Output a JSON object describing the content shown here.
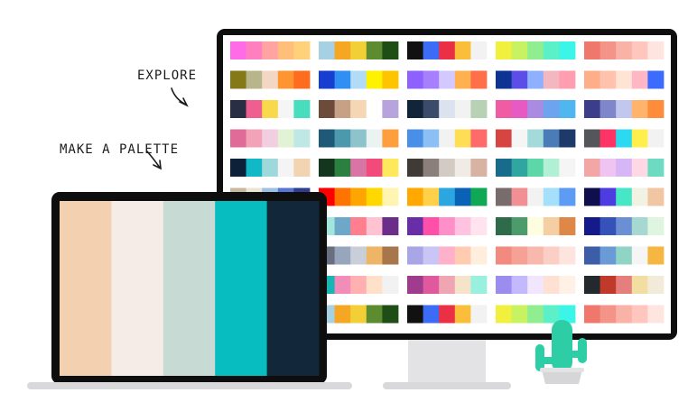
{
  "labels": {
    "explore": "EXPLORE",
    "make_palette": "MAKE A PALETTE"
  },
  "icons": [
    "arrow-explore-icon",
    "arrow-make-palette-icon",
    "cactus-icon"
  ],
  "laptop_palette": [
    "#F2D0B0",
    "#F5ECE8",
    "#C7DAD3",
    "#08BDC0",
    "#12283A"
  ],
  "monitor_palettes": [
    [
      [
        "#FF6BE6",
        "#FF80BF",
        "#FFA3A3",
        "#FFBE7A",
        "#FFD27A"
      ],
      [
        "#A6D0E4",
        "#F5A623",
        "#F2CF36",
        "#5D8B30",
        "#1F4D16"
      ],
      [
        "#111111",
        "#3C6BF5",
        "#EB2F45",
        "#FBBE3A",
        "#F2F2F2"
      ],
      [
        "#F2F03E",
        "#C7F262",
        "#90EE90",
        "#5BF0C8",
        "#3CF5E9"
      ],
      [
        "#F0776B",
        "#F49488",
        "#F9B2A6",
        "#FFC6BE",
        "#FFE5E0"
      ]
    ],
    [
      [
        "#857817",
        "#B8B48B",
        "#F2D7C4",
        "#FF9433",
        "#FF6B1F"
      ],
      [
        "#163ED0",
        "#2F8FF2",
        "#B2DBF5",
        "#FFF200",
        "#FFC400"
      ],
      [
        "#8E61FF",
        "#A67FFF",
        "#D4C9FF",
        "#FFB14F",
        "#FF6F4A"
      ],
      [
        "#0D3393",
        "#5C4DE6",
        "#8FB0FF",
        "#F2B7C0",
        "#FF9EB0"
      ],
      [
        "#FFAE8A",
        "#FFC3AD",
        "#FFE3D4",
        "#FFB7C5",
        "#3B6BFF"
      ]
    ],
    [
      [
        "#2A2E45",
        "#EF5E8F",
        "#F9D94C",
        "#F5F5F5",
        "#48DDBC"
      ],
      [
        "#6D4B3A",
        "#C7A185",
        "#F5D6B5",
        "#FFFFFF",
        "#B8A4DD"
      ],
      [
        "#10243A",
        "#3B4C6B",
        "#DCE3EE",
        "#F2F2F2",
        "#B7D1B5"
      ],
      [
        "#F05CA4",
        "#E75AC4",
        "#A98BE2",
        "#6EA3F0",
        "#4FB6F0"
      ],
      [
        "#3C3E8C",
        "#7F86C9",
        "#C2C7EE",
        "#FFB36B",
        "#FF8C3A"
      ]
    ],
    [
      [
        "#E06A98",
        "#F2A3B8",
        "#F2CFE0",
        "#E2F2D5",
        "#BFE8E5"
      ],
      [
        "#1E5A78",
        "#4C99AE",
        "#8FC3CC",
        "#EAF2F2",
        "#FF9E3D"
      ],
      [
        "#4A8FE7",
        "#8CC0F5",
        "#F2F2F2",
        "#FFDD55",
        "#FF6B6B"
      ],
      [
        "#D64541",
        "#F5F5F5",
        "#A5DADB",
        "#4A7DB8",
        "#1E3A6A"
      ],
      [
        "#55565C",
        "#FF3366",
        "#2BD9F0",
        "#FFEF4D",
        "#F2F2F2"
      ]
    ],
    [
      [
        "#0D2238",
        "#13B8C6",
        "#9FD8DA",
        "#F4F4F4",
        "#F2D3B2"
      ],
      [
        "#14361E",
        "#2B8040",
        "#D975A5",
        "#F24A7A",
        "#FFE85C"
      ],
      [
        "#403A36",
        "#8A7F7A",
        "#D2CBC4",
        "#F0ECE5",
        "#D8B2A2"
      ],
      [
        "#186B8A",
        "#2FA6A0",
        "#5DD6A8",
        "#B1F0D4",
        "#F5F5F5"
      ],
      [
        "#F2A6A6",
        "#EFC4F2",
        "#D6B6F5",
        "#FFD8E5",
        "#6DDBC2"
      ]
    ],
    [
      [
        "#C9B99E",
        "#ECE4D5",
        "#9EC0E3",
        "#5676D4",
        "#2F3D8F"
      ],
      [
        "#FF0000",
        "#FF7300",
        "#FFA500",
        "#FFD800",
        "#FFF5B0"
      ],
      [
        "#FFA800",
        "#FFD14A",
        "#2AA6E0",
        "#0A62B7",
        "#0FA855"
      ],
      [
        "#796C6C",
        "#F28F95",
        "#F2F2F2",
        "#A5DFFA",
        "#5D9CF5"
      ],
      [
        "#0F0F4D",
        "#4D3CE0",
        "#47E6C6",
        "#F2F2E4",
        "#F2C6A3"
      ]
    ],
    [
      [
        "#2D8A2D",
        "#F5F5F5",
        "#FFC400",
        "#FF5E1A",
        "#FF1744"
      ],
      [
        "#A0E6DC",
        "#6DA8C9",
        "#FF7F8F",
        "#FFC2D1",
        "#6A2D8A"
      ],
      [
        "#6A2DA8",
        "#FF4FA8",
        "#FF8FC9",
        "#FFC2E0",
        "#FFE4F0"
      ],
      [
        "#2D6B4B",
        "#4C9B6B",
        "#FFFDE0",
        "#F5CFA3",
        "#DE8746"
      ],
      [
        "#141A8A",
        "#3452B8",
        "#6B8FD4",
        "#A5D8D0",
        "#E0F5E0"
      ]
    ],
    [
      [
        "#5E6478",
        "#A69BCA",
        "#A9C8E0",
        "#C6ECE6",
        "#D6CC9B"
      ],
      [
        "#6A6E7E",
        "#98A6BD",
        "#C9CFD8",
        "#EFB566",
        "#A8764B"
      ],
      [
        "#A8A6E6",
        "#C9C6F5",
        "#FFB0CB",
        "#FFCCB2",
        "#FFEEDD"
      ],
      [
        "#F28A7F",
        "#F6A196",
        "#F9B8AE",
        "#FCCFC6",
        "#FDE4DE"
      ],
      [
        "#3D5DA8",
        "#6B9BD6",
        "#8FD4C5",
        "#F5F5F5",
        "#F5B742"
      ]
    ],
    [
      [
        "#F5D0B0",
        "#F2A1A1",
        "#D4B9BD",
        "#C3F0E6",
        "#AADAF5"
      ],
      [
        "#18B5B5",
        "#F28CB8",
        "#FFB0B0",
        "#FFE0C9",
        "#F2F2F2"
      ],
      [
        "#A03C8E",
        "#E0599F",
        "#F0A5B2",
        "#F5E4C9",
        "#9AF0DF"
      ],
      [
        "#9B8CF0",
        "#C4B8FF",
        "#F2E6FF",
        "#FFE1D4",
        "#FFF1E6"
      ],
      [
        "#24292E",
        "#C0392B",
        "#E67E7E",
        "#F2DEA0",
        "#F2EBD9"
      ]
    ],
    [
      [
        "#FF6BE6",
        "#FF80BF",
        "#FFA3A3",
        "#FFBE7A",
        "#FFD27A"
      ],
      [
        "#A6D0E4",
        "#F5A623",
        "#F2CF36",
        "#5D8B30",
        "#1F4D16"
      ],
      [
        "#111111",
        "#3C6BF5",
        "#EB2F45",
        "#FBBE3A",
        "#F2F2F2"
      ],
      [
        "#F2F03E",
        "#C7F262",
        "#90EE90",
        "#5BF0C8",
        "#3CF5E9"
      ],
      [
        "#F0776B",
        "#F49488",
        "#F9B2A6",
        "#FFC6BE",
        "#FFE5E0"
      ]
    ],
    [
      [
        "#857817",
        "#B8B48B",
        "#F2D7C4",
        "#FF9433",
        "#FF6B1F"
      ],
      [
        "#163ED0",
        "#2F8FF2",
        "#B2DBF5",
        "#FFF200",
        "#FFC400"
      ],
      [
        "#8E61FF",
        "#A67FFF",
        "#D4C9FF",
        "#FFB14F",
        "#FF6F4A"
      ],
      [
        "#0D3393",
        "#5C4DE6",
        "#8FB0FF",
        "#F2B7C0",
        "#FF9EB0"
      ],
      [
        "#FFAE8A",
        "#FFC3AD",
        "#FFE3D4",
        "#FFB7C5",
        "#3B6BFF"
      ]
    ]
  ],
  "colors": {
    "frame": "#0E0E0E",
    "stand": "#E3E3E6",
    "laptop_base": "#D9D9DC",
    "cactus": "#2DCEA6",
    "pot": "#D6D6D9",
    "label": "#1B1B1B"
  }
}
